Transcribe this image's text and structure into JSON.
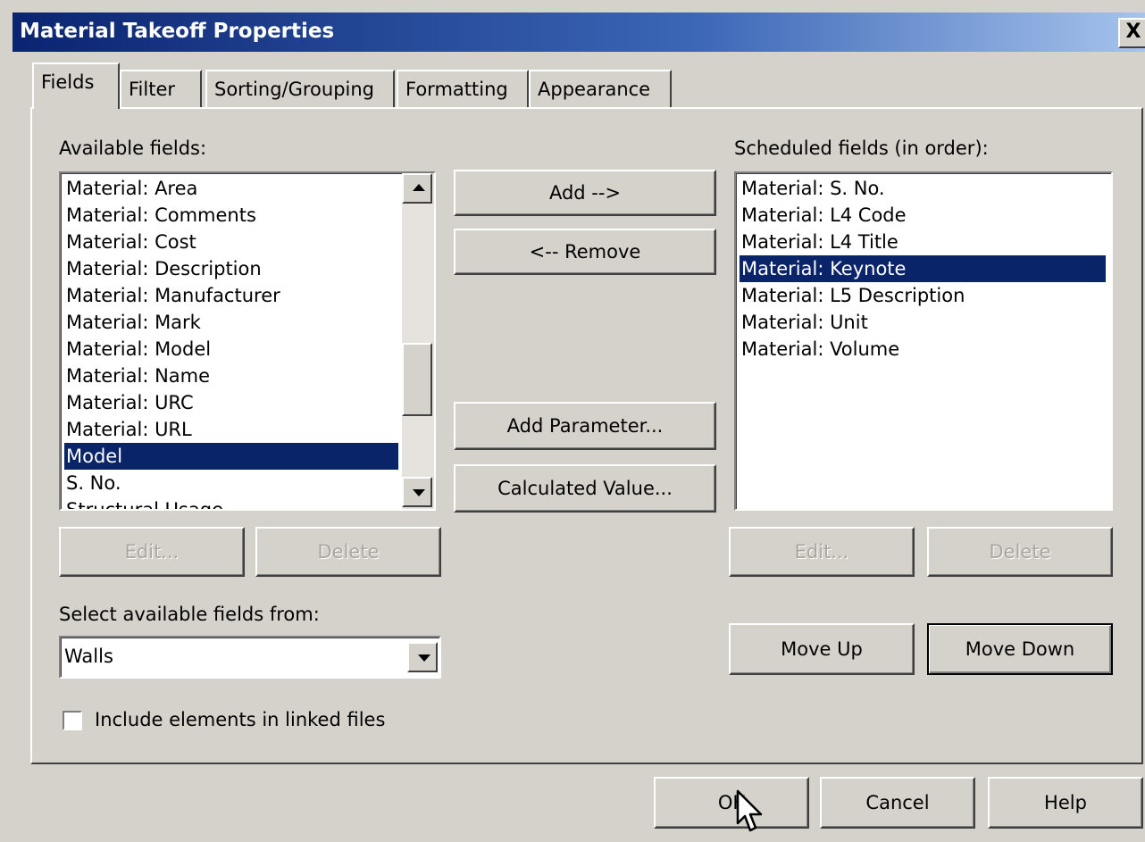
{
  "window": {
    "title": "Material Takeoff Properties",
    "close_glyph": "X"
  },
  "tabs": [
    "Fields",
    "Filter",
    "Sorting/Grouping",
    "Formatting",
    "Appearance"
  ],
  "available": {
    "label": "Available fields:",
    "items": [
      "Material: Area",
      "Material: Comments",
      "Material: Cost",
      "Material: Description",
      "Material: Manufacturer",
      "Material: Mark",
      "Material: Model",
      "Material: Name",
      "Material: URC",
      "Material: URL",
      "Model",
      "S. No.",
      "Structural Usage"
    ],
    "selected": "Model",
    "edit_label": "Edit...",
    "delete_label": "Delete"
  },
  "middle": {
    "add_label": "Add -->",
    "remove_label": "<-- Remove",
    "add_parameter_label": "Add Parameter...",
    "calculated_value_label": "Calculated Value..."
  },
  "scheduled": {
    "label": "Scheduled fields (in order):",
    "items": [
      "Material: S. No.",
      "Material: L4 Code",
      "Material: L4 Title",
      "Material: Keynote",
      "Material: L5 Description",
      "Material: Unit",
      "Material: Volume"
    ],
    "selected": "Material: Keynote",
    "edit_label": "Edit...",
    "delete_label": "Delete",
    "move_up_label": "Move Up",
    "move_down_label": "Move Down"
  },
  "source": {
    "label": "Select available fields from:",
    "value": "Walls"
  },
  "include_linked": {
    "label": "Include elements in linked files",
    "checked": false
  },
  "footer": {
    "ok_label": "OK",
    "cancel_label": "Cancel",
    "help_label": "Help"
  },
  "icons": {
    "cursor": "mouse-pointer-icon",
    "dropdown": "chevron-down-icon"
  }
}
